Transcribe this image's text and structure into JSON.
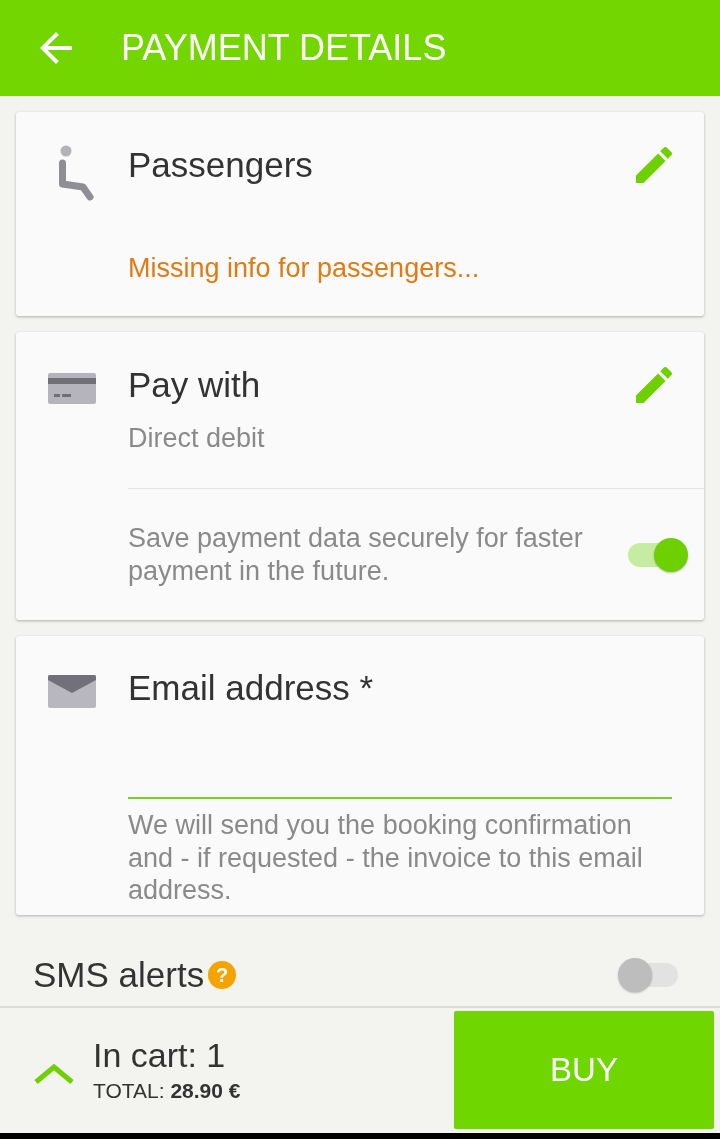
{
  "app_bar": {
    "title": "PAYMENT DETAILS"
  },
  "cards": [
    {
      "kind": "passengers",
      "title": "Passengers",
      "editable": true,
      "warning": "Missing info for passengers..."
    },
    {
      "kind": "payment",
      "title": "Pay with",
      "editable": true,
      "value": "Direct debit",
      "save_option": {
        "label": "Save payment data securely for faster payment in the future.",
        "on": true
      }
    },
    {
      "kind": "email",
      "title": "Email address *",
      "editable": false,
      "helper": "We will send you the booking confirmation and - if requested - the invoice to this email address."
    }
  ],
  "sms_alerts": {
    "label": "SMS alerts",
    "help": "?",
    "on": false
  },
  "cart": {
    "count": "In cart: 1",
    "total": "TOTAL: **28.90 €**"
  },
  "buy_button": {
    "label": "BUY"
  }
}
